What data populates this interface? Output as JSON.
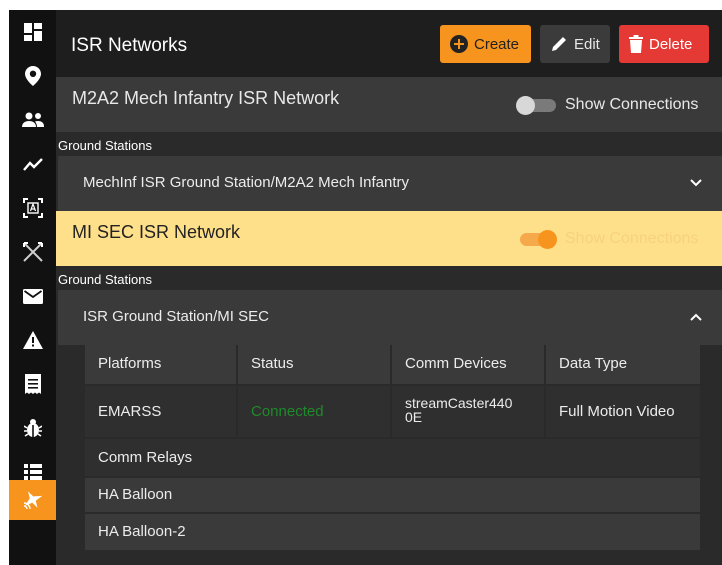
{
  "header": {
    "title": "ISR Networks",
    "create_label": "Create",
    "edit_label": "Edit",
    "delete_label": "Delete"
  },
  "sidebar": {
    "items": [
      {
        "icon": "dashboard-icon"
      },
      {
        "icon": "map-pin-icon"
      },
      {
        "icon": "people-icon"
      },
      {
        "icon": "trend-icon"
      },
      {
        "icon": "target-frame-icon"
      },
      {
        "icon": "crossed-swords-icon"
      },
      {
        "icon": "mail-icon"
      },
      {
        "icon": "warning-icon"
      },
      {
        "icon": "receipt-icon"
      },
      {
        "icon": "bug-icon"
      },
      {
        "icon": "list-icon"
      },
      {
        "icon": "aircraft-signal-icon",
        "active": true
      }
    ]
  },
  "networks": [
    {
      "title": "M2A2 Mech Infantry ISR Network",
      "toggle_label": "Show Connections",
      "toggle_on": false,
      "section_label": "Ground Stations",
      "station": "MechInf ISR Ground Station/M2A2 Mech Infantry"
    },
    {
      "title": "MI SEC ISR Network",
      "toggle_label": "Show Connections",
      "toggle_on": true,
      "section_label": "Ground Stations",
      "station": "ISR Ground Station/MI SEC"
    }
  ],
  "detail": {
    "headers": [
      "Platforms",
      "Status",
      "Comm Devices",
      "Data Type"
    ],
    "platform": "EMARSS",
    "status": "Connected",
    "comm_device_line1": "streamCaster440",
    "comm_device_line2": "0E",
    "data_type": "Full Motion Video",
    "relays_header": "Comm Relays",
    "relays": [
      "HA Balloon",
      "HA Balloon-2"
    ]
  },
  "colors": {
    "accent": "#f7941d",
    "delete": "#e53935",
    "highlight": "#ffe08a",
    "connected": "#1f8a2a"
  }
}
